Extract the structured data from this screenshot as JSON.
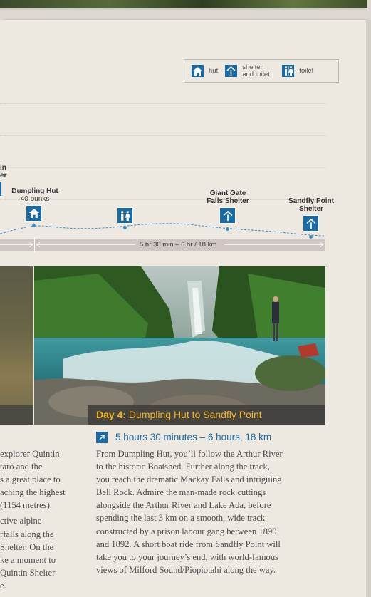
{
  "legend": {
    "items": [
      {
        "icon": "hut-icon",
        "label": "hut"
      },
      {
        "icon": "shelter-icon",
        "label": "shelter and toilet"
      },
      {
        "icon": "toilet-icon",
        "label": "toilet"
      }
    ]
  },
  "profile": {
    "prev_hut_fragment": "in\ner",
    "dumpling": {
      "name": "Dumpling Hut",
      "bunks": "40 bunks"
    },
    "giant_gate": {
      "name": "Giant Gate\nFalls Shelter"
    },
    "sandfly": {
      "name": "Sandfly Point\nShelter"
    },
    "distance": "5 hr 30 min – 6 hr / 18 km"
  },
  "photo": {
    "caption_day": "Day 4:",
    "caption_route": "Dumpling Hut to Sandfly Point"
  },
  "left_column": {
    "lines": [
      "explorer Quintin",
      "taro and the",
      "s a great place to",
      "aching the highest",
      "(1154 metres).",
      "",
      "ctive alpine",
      "rfalls along the",
      "Shelter. On the",
      "ke a moment to",
      "Quintin Shelter",
      "e."
    ]
  },
  "day4": {
    "duration": "5 hours 30 minutes – 6 hours, 18 km",
    "lines": [
      "From Dumpling Hut, you’ll follow the Arthur River",
      "to the historic Boatshed. Further along the track,",
      "you reach the dramatic Mackay Falls and intriguing",
      "Bell Rock. Admire the man-made rock cuttings",
      "alongside the Arthur River and Lake Ada, before",
      "spending the last 3 km on a smooth, wide track",
      "constructed by a prison labour gang between 1890",
      "and 1892. A short boat ride from Sandfly Point will",
      "take you to your journey’s end, with world-famous",
      "views of Milford Sound/Piopiotahi along the way."
    ]
  },
  "colors": {
    "brand_blue": "#1a6aa6",
    "caption_yellow": "#f0b41c",
    "paper": "#ede9e1"
  }
}
